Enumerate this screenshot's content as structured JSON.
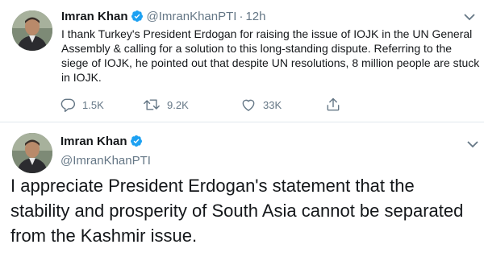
{
  "tweet1": {
    "author_name": "Imran Khan",
    "handle": "@ImranKhanPTI",
    "separator": "·",
    "time": "12h",
    "text": "I thank Turkey's President Erdogan for raising the issue of IOJK in the UN General Assembly & calling for a solution to this long-standing dispute. Referring to the siege of IOJK, he pointed out that despite UN resolutions, 8 million people are stuck in IOJK.",
    "replies": "1.5K",
    "retweets": "9.2K",
    "likes": "33K"
  },
  "tweet2": {
    "author_name": "Imran Khan",
    "handle": "@ImranKhanPTI",
    "text": "I appreciate President Erdogan's statement that the stability and prosperity of South Asia cannot be separated from the Kashmir issue."
  },
  "colors": {
    "verified": "#1da1f2",
    "secondary_text": "#657786",
    "divider": "#e1e8ed"
  }
}
